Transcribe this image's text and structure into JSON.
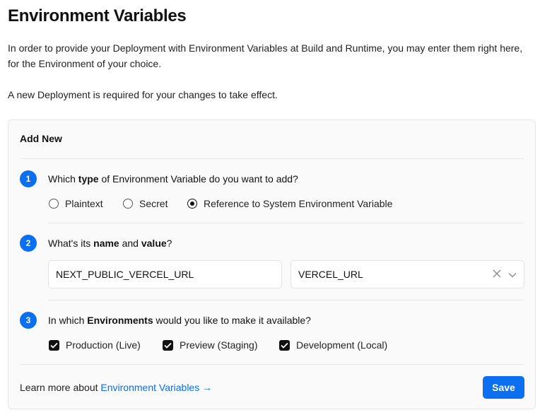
{
  "page": {
    "title": "Environment Variables",
    "intro": "In order to provide your Deployment with Environment Variables at Build and Runtime, you may enter them right here, for the Environment of your choice.",
    "note": "A new Deployment is required for your changes to take effect."
  },
  "card": {
    "title": "Add New",
    "step1": {
      "number": "1",
      "question_pre": "Which ",
      "question_bold": "type",
      "question_post": " of Environment Variable do you want to add?",
      "options": [
        {
          "label": "Plaintext",
          "checked": false
        },
        {
          "label": "Secret",
          "checked": false
        },
        {
          "label": "Reference to System Environment Variable",
          "checked": true
        }
      ]
    },
    "step2": {
      "number": "2",
      "question_pre": "What's its ",
      "question_bold1": "name",
      "question_mid": " and ",
      "question_bold2": "value",
      "question_post": "?",
      "name_value": "NEXT_PUBLIC_VERCEL_URL",
      "value_selected": "VERCEL_URL"
    },
    "step3": {
      "number": "3",
      "question_pre": "In which ",
      "question_bold": "Environments",
      "question_post": " would you like to make it available?",
      "environments": [
        {
          "label": "Production (Live)",
          "checked": true
        },
        {
          "label": "Preview (Staging)",
          "checked": true
        },
        {
          "label": "Development (Local)",
          "checked": true
        }
      ]
    },
    "footer": {
      "text": "Learn more about ",
      "link": "Environment Variables →",
      "save_label": "Save"
    }
  },
  "colors": {
    "accent": "#0b6ff0",
    "card_bg": "#fafafa"
  }
}
